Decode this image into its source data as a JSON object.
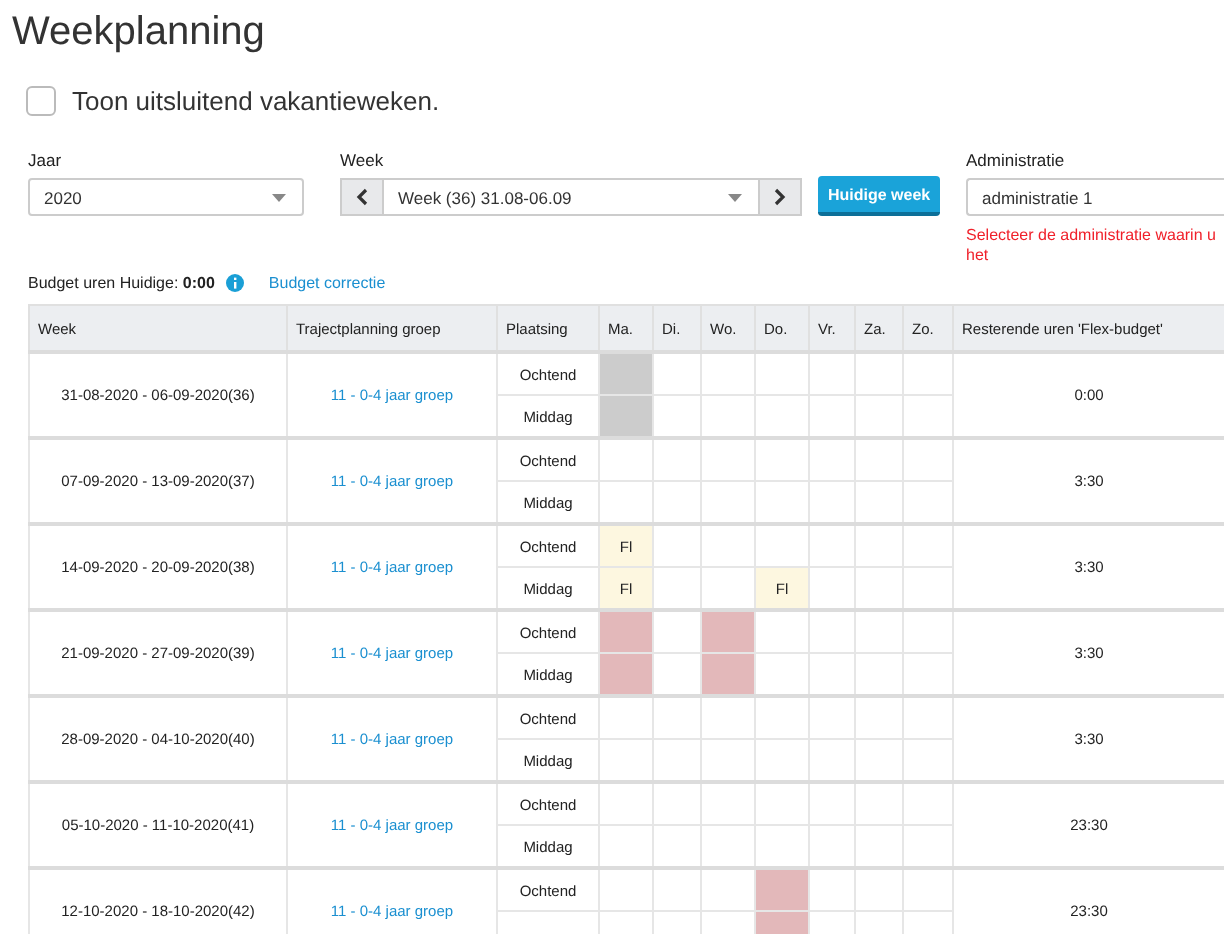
{
  "page": {
    "title": "Weekplanning"
  },
  "vacation_filter": {
    "label": "Toon uitsluitend vakantieweken.",
    "checked": false
  },
  "filters": {
    "year": {
      "label": "Jaar",
      "value": "2020"
    },
    "week": {
      "label": "Week",
      "value": "Week (36) 31.08-06.09"
    },
    "current_week_button": "Huidige week",
    "administration": {
      "label": "Administratie",
      "value": "administratie 1",
      "error": "Selecteer de administratie waarin u het"
    }
  },
  "budget": {
    "text": "Budget uren Huidige: **0:00**",
    "link": "Budget correctie"
  },
  "table": {
    "columns": [
      "Week",
      "Trajectplanning groep",
      "Plaatsing",
      "Ma.",
      "Di.",
      "Wo.",
      "Do.",
      "Vr.",
      "Za.",
      "Zo.",
      "Resterende uren 'Flex-budget'"
    ],
    "rows": [
      {
        "week": "31-08-2020 - 06-09-2020(36)",
        "group": "11 - 0-4 jaar groep",
        "remaining": "0:00",
        "slots": [
          {
            "label": "Ochtend",
            "days": [
              {
                "kind": "closed"
              },
              {
                "kind": "empty"
              },
              {
                "kind": "empty"
              },
              {
                "kind": "empty"
              },
              {
                "kind": "empty"
              },
              {
                "kind": "empty"
              },
              {
                "kind": "empty"
              }
            ]
          },
          {
            "label": "Middag",
            "days": [
              {
                "kind": "closed"
              },
              {
                "kind": "empty"
              },
              {
                "kind": "empty"
              },
              {
                "kind": "empty"
              },
              {
                "kind": "empty"
              },
              {
                "kind": "empty"
              },
              {
                "kind": "empty"
              }
            ]
          }
        ]
      },
      {
        "week": "07-09-2020 - 13-09-2020(37)",
        "group": "11 - 0-4 jaar groep",
        "remaining": "3:30",
        "slots": [
          {
            "label": "Ochtend",
            "days": [
              {
                "kind": "empty"
              },
              {
                "kind": "empty"
              },
              {
                "kind": "empty"
              },
              {
                "kind": "empty"
              },
              {
                "kind": "empty"
              },
              {
                "kind": "empty"
              },
              {
                "kind": "empty"
              }
            ]
          },
          {
            "label": "Middag",
            "days": [
              {
                "kind": "empty"
              },
              {
                "kind": "empty"
              },
              {
                "kind": "empty"
              },
              {
                "kind": "empty"
              },
              {
                "kind": "empty"
              },
              {
                "kind": "empty"
              },
              {
                "kind": "empty"
              }
            ]
          }
        ]
      },
      {
        "week": "14-09-2020 - 20-09-2020(38)",
        "group": "11 - 0-4 jaar groep",
        "remaining": "3:30",
        "slots": [
          {
            "label": "Ochtend",
            "days": [
              {
                "kind": "flex",
                "text": "Fl"
              },
              {
                "kind": "empty"
              },
              {
                "kind": "empty"
              },
              {
                "kind": "empty"
              },
              {
                "kind": "empty"
              },
              {
                "kind": "empty"
              },
              {
                "kind": "empty"
              }
            ]
          },
          {
            "label": "Middag",
            "days": [
              {
                "kind": "flex",
                "text": "Fl"
              },
              {
                "kind": "empty"
              },
              {
                "kind": "empty"
              },
              {
                "kind": "flex",
                "text": "Fl"
              },
              {
                "kind": "empty"
              },
              {
                "kind": "empty"
              },
              {
                "kind": "empty"
              }
            ]
          }
        ]
      },
      {
        "week": "21-09-2020 - 27-09-2020(39)",
        "group": "11 - 0-4 jaar groep",
        "remaining": "3:30",
        "slots": [
          {
            "label": "Ochtend",
            "days": [
              {
                "kind": "absent"
              },
              {
                "kind": "empty"
              },
              {
                "kind": "absent"
              },
              {
                "kind": "empty"
              },
              {
                "kind": "empty"
              },
              {
                "kind": "empty"
              },
              {
                "kind": "empty"
              }
            ]
          },
          {
            "label": "Middag",
            "days": [
              {
                "kind": "absent"
              },
              {
                "kind": "empty"
              },
              {
                "kind": "absent"
              },
              {
                "kind": "empty"
              },
              {
                "kind": "empty"
              },
              {
                "kind": "empty"
              },
              {
                "kind": "empty"
              }
            ]
          }
        ]
      },
      {
        "week": "28-09-2020 - 04-10-2020(40)",
        "group": "11 - 0-4 jaar groep",
        "remaining": "3:30",
        "slots": [
          {
            "label": "Ochtend",
            "days": [
              {
                "kind": "empty"
              },
              {
                "kind": "empty"
              },
              {
                "kind": "empty"
              },
              {
                "kind": "empty"
              },
              {
                "kind": "empty"
              },
              {
                "kind": "empty"
              },
              {
                "kind": "empty"
              }
            ]
          },
          {
            "label": "Middag",
            "days": [
              {
                "kind": "empty"
              },
              {
                "kind": "empty"
              },
              {
                "kind": "empty"
              },
              {
                "kind": "empty"
              },
              {
                "kind": "empty"
              },
              {
                "kind": "empty"
              },
              {
                "kind": "empty"
              }
            ]
          }
        ]
      },
      {
        "week": "05-10-2020 - 11-10-2020(41)",
        "group": "11 - 0-4 jaar groep",
        "remaining": "23:30",
        "slots": [
          {
            "label": "Ochtend",
            "days": [
              {
                "kind": "empty"
              },
              {
                "kind": "empty"
              },
              {
                "kind": "empty"
              },
              {
                "kind": "empty"
              },
              {
                "kind": "empty"
              },
              {
                "kind": "empty"
              },
              {
                "kind": "empty"
              }
            ]
          },
          {
            "label": "Middag",
            "days": [
              {
                "kind": "empty"
              },
              {
                "kind": "empty"
              },
              {
                "kind": "empty"
              },
              {
                "kind": "empty"
              },
              {
                "kind": "empty"
              },
              {
                "kind": "empty"
              },
              {
                "kind": "empty"
              }
            ]
          }
        ]
      },
      {
        "week": "12-10-2020 - 18-10-2020(42)",
        "group": "11 - 0-4 jaar groep",
        "remaining": "23:30",
        "slots": [
          {
            "label": "Ochtend",
            "days": [
              {
                "kind": "empty"
              },
              {
                "kind": "empty"
              },
              {
                "kind": "empty"
              },
              {
                "kind": "absent"
              },
              {
                "kind": "empty"
              },
              {
                "kind": "empty"
              },
              {
                "kind": "empty"
              }
            ]
          },
          {
            "days": [
              {
                "kind": "empty"
              },
              {
                "kind": "empty"
              },
              {
                "kind": "empty"
              },
              {
                "kind": "absent"
              },
              {
                "kind": "empty"
              },
              {
                "kind": "empty"
              },
              {
                "kind": "empty"
              }
            ]
          }
        ]
      }
    ]
  }
}
